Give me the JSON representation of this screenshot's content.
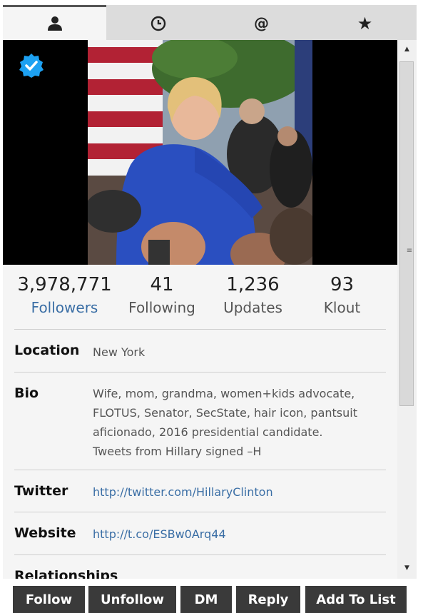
{
  "tabs": [
    {
      "icon": "user-icon",
      "glyph": "👤"
    },
    {
      "icon": "clock-icon",
      "glyph": "🕓"
    },
    {
      "icon": "at-icon",
      "glyph": "@"
    },
    {
      "icon": "star-icon",
      "glyph": "★"
    }
  ],
  "stats": [
    {
      "value": "3,978,771",
      "label": "Followers"
    },
    {
      "value": "41",
      "label": "Following"
    },
    {
      "value": "1,236",
      "label": "Updates"
    },
    {
      "value": "93",
      "label": "Klout"
    }
  ],
  "profile": {
    "location_label": "Location",
    "location": "New York",
    "bio_label": "Bio",
    "bio_lines": [
      "Wife, mom, grandma, women+kids advocate,",
      "FLOTUS, Senator, SecState, hair icon, pantsuit",
      "aficionado, 2016 presidential candidate.",
      "Tweets from Hillary signed –H"
    ],
    "twitter_label": "Twitter",
    "twitter": "http://twitter.com/HillaryClinton",
    "website_label": "Website",
    "website": "http://t.co/ESBw0Arq44",
    "relationships_label": "Relationships"
  },
  "actions": {
    "follow": "Follow",
    "unfollow": "Unfollow",
    "dm": "DM",
    "reply": "Reply",
    "add_to_list": "Add To List"
  },
  "colors": {
    "link": "#3a6ea5",
    "verified": "#1da1f2",
    "button_bg": "#3a3a3a"
  }
}
